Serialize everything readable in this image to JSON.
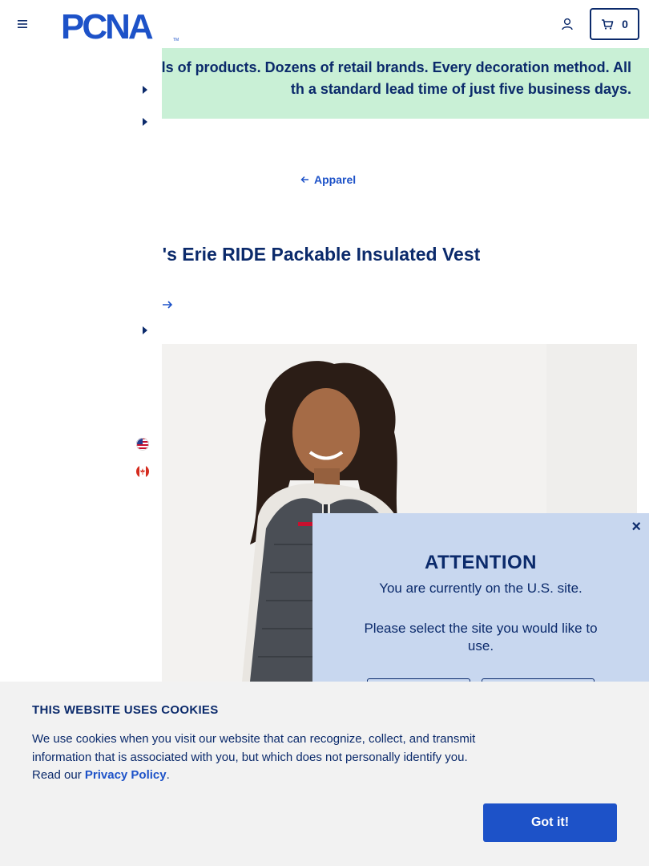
{
  "header": {
    "logo_text": "PCNA",
    "logo_tm": "TM",
    "cart_count": "0"
  },
  "banner": {
    "line1": "ls of products. Dozens of retail brands. Every decoration method. All",
    "line2": "th a standard lead time of just five business days."
  },
  "breadcrumb": {
    "label": "Apparel"
  },
  "product": {
    "title": "Women's Erie RIDE Packable Insulated Vest"
  },
  "left_rail": {
    "flags": [
      "us-flag-icon",
      "canada-flag-icon"
    ]
  },
  "attention": {
    "close": "×",
    "title": "ATTENTION",
    "current_site": "You are currently on the U.S. site.",
    "prompt": "Please select the site you would like to use."
  },
  "cookie": {
    "title": "THIS WEBSITE USES COOKIES",
    "text_before": "We use cookies when you visit our website that can recognize, collect, and transmit information that is associated with you, but which does not personally identify you. Read our ",
    "link_text": "Privacy Policy",
    "text_after": ".",
    "button": "Got it!"
  },
  "colors": {
    "brand_navy": "#0b2a6b",
    "link_blue": "#1d52c8",
    "banner_green": "#c9f0d6",
    "modal_blue": "#c8d7ef"
  }
}
